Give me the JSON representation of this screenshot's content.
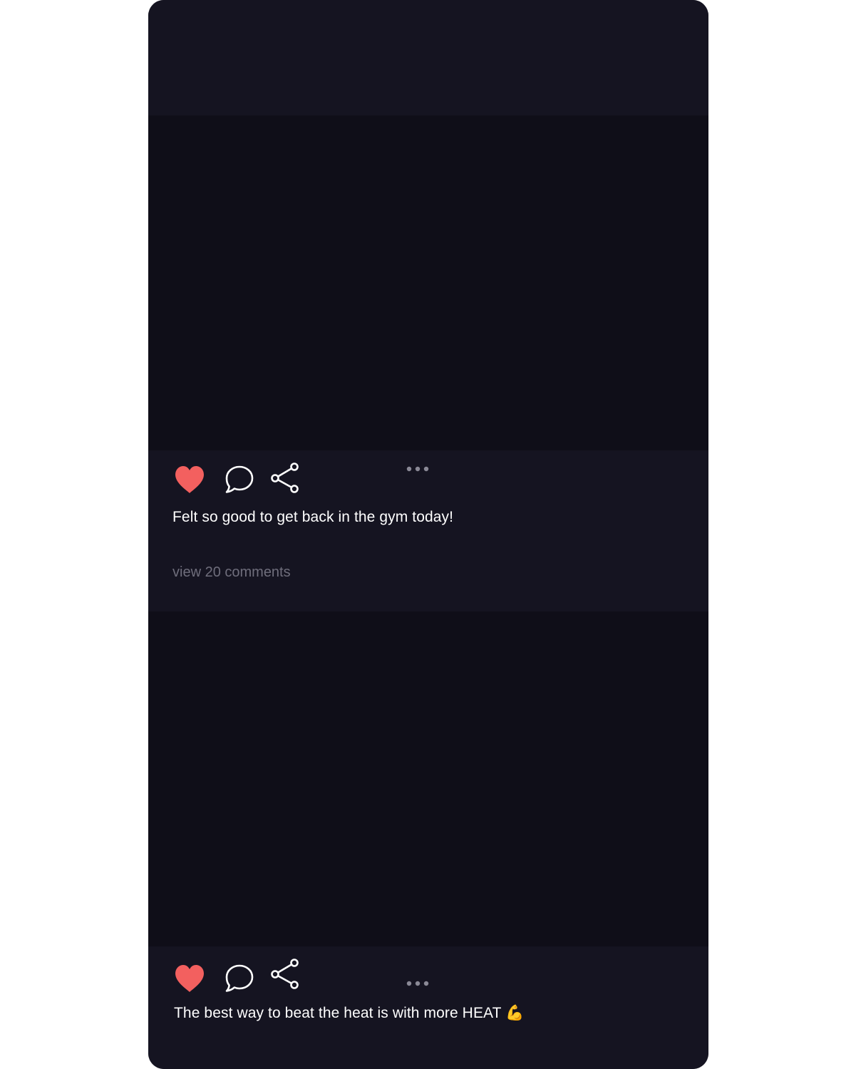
{
  "posts": [
    {
      "caption": "Felt so good to get back in the gym today!",
      "comments_link": "view 20 comments",
      "liked": true
    },
    {
      "caption": "The best way to beat the heat is with more HEAT 💪",
      "liked": true
    }
  ],
  "icons": {
    "like": "heart-icon",
    "comment": "speech-bubble-icon",
    "share": "share-icon",
    "more": "more-options-icon"
  },
  "colors": {
    "background": "#151421",
    "image_placeholder": "#0f0e18",
    "like_active": "#f3605f",
    "text": "#ffffff",
    "muted_text": "#6f6e7c"
  }
}
